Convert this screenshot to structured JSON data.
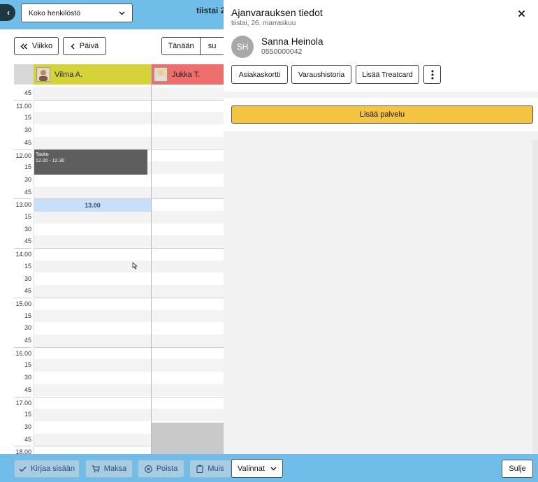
{
  "calendar": {
    "back_icon": "chevron-left-icon",
    "staff_filter": {
      "value": "Koko henkilöstö"
    },
    "date_title": "tiistai 2",
    "nav": {
      "week": "Viikko",
      "day": "Päivä",
      "today": "Tänään",
      "day_abbrev": "su"
    },
    "staff": [
      {
        "name": "Vilma A.",
        "color": "#d6d33a"
      },
      {
        "name": "Jukka T.",
        "color": "#ee6e6e"
      }
    ],
    "time_labels": [
      "45",
      "11.00",
      "15",
      "30",
      "45",
      "12.00",
      "15",
      "30",
      "45",
      "13.00",
      "15",
      "30",
      "45",
      "14.00",
      "15",
      "30",
      "45",
      "15.00",
      "15",
      "30",
      "45",
      "16.00",
      "15",
      "30",
      "45",
      "17.00",
      "15",
      "30",
      "45",
      "18.00"
    ],
    "break_block": {
      "title": "Tauko",
      "time": "12.00 - 12.30"
    },
    "selected_slot": "13.00"
  },
  "actions": {
    "checkin": "Kirjaa sisään",
    "pay": "Maksa",
    "delete": "Poista",
    "note": "Muis"
  },
  "panel": {
    "title": "Ajanvarauksen tiedot",
    "date": "tiistai, 26. marraskuu",
    "customer": {
      "initials": "SH",
      "name": "Sanna Heinola",
      "phone": "0550000042"
    },
    "buttons": {
      "card": "Asiakaskortti",
      "history": "Varaushistoria",
      "treatcard": "Lisää Treatcard"
    },
    "add_service": "Lisää palvelu",
    "footer": {
      "options": "Valinnat",
      "close": "Sulje"
    }
  },
  "colors": {
    "topbar": "#6fbde8",
    "accent_yellow": "#f4c542",
    "break_gray": "#5e5e5e",
    "slot_blue": "#c7dffa"
  }
}
